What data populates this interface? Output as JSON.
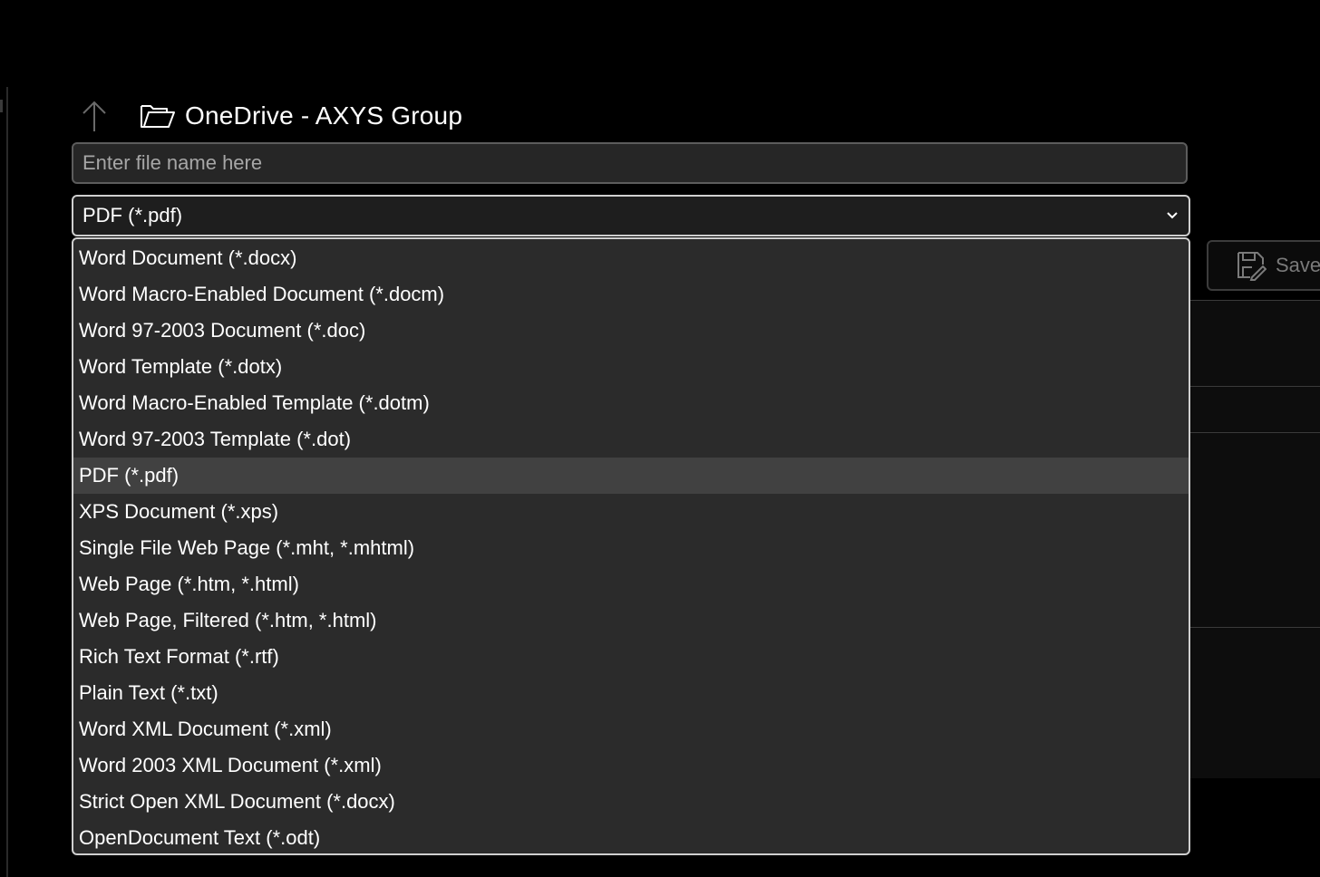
{
  "location": {
    "up_icon": "arrow-up-icon",
    "folder_icon": "folder-open-icon",
    "label": "OneDrive - AXYS Group"
  },
  "filename": {
    "value": "",
    "placeholder": "Enter file name here"
  },
  "file_type": {
    "selected": "PDF (*.pdf)",
    "chevron_icon": "chevron-down-icon",
    "options": [
      "Word Document (*.docx)",
      "Word Macro-Enabled Document (*.docm)",
      "Word 97-2003 Document (*.doc)",
      "Word Template (*.dotx)",
      "Word Macro-Enabled Template (*.dotm)",
      "Word 97-2003 Template (*.dot)",
      "PDF (*.pdf)",
      "XPS Document (*.xps)",
      "Single File Web Page (*.mht, *.mhtml)",
      "Web Page (*.htm, *.html)",
      "Web Page, Filtered (*.htm, *.html)",
      "Rich Text Format (*.rtf)",
      "Plain Text (*.txt)",
      "Word XML Document (*.xml)",
      "Word 2003 XML Document (*.xml)",
      "Strict Open XML Document (*.docx)",
      "OpenDocument Text (*.odt)"
    ],
    "highlighted_index": 6
  },
  "save_button": {
    "label": "Save",
    "icon": "save-icon"
  },
  "colors": {
    "background": "#000000",
    "dropdown_bg": "#2b2b2b",
    "highlight_bg": "#414141",
    "border_focus": "#cfcfcf",
    "placeholder": "#a6a6a6"
  }
}
